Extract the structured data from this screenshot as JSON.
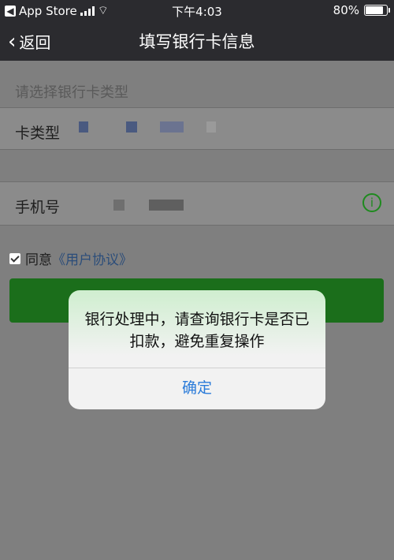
{
  "status_bar": {
    "carrier": "App Store",
    "time": "下午4:03",
    "battery": "80%"
  },
  "nav": {
    "back_label": "返回",
    "title": "填写银行卡信息"
  },
  "form": {
    "section_label": "请选择银行卡类型",
    "card_type_label": "卡类型",
    "phone_label": "手机号",
    "agree_text": "同意",
    "agreement_link": "《用户协议》"
  },
  "alert": {
    "message": "银行处理中，请查询银行卡是否已扣款，避免重复操作",
    "button_label": "确定"
  },
  "colors": {
    "accent": "#2a7bd9",
    "primary_button": "#1b6e1b",
    "info": "#1e8a1e"
  }
}
